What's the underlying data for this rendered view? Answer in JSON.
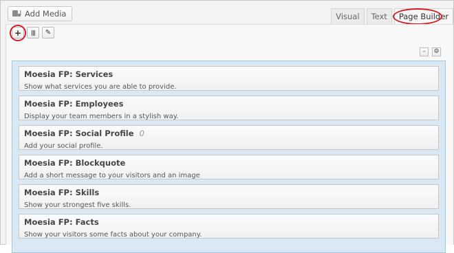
{
  "toolbar": {
    "add_media_label": "Add Media",
    "add_media_icon": "media-icon"
  },
  "tabs": [
    {
      "label": "Visual",
      "active": false
    },
    {
      "label": "Text",
      "active": false
    },
    {
      "label": "Page Builder",
      "active": true
    }
  ],
  "builder_tools": [
    {
      "icon": "plus-icon",
      "glyph": "+"
    },
    {
      "icon": "columns-icon",
      "glyph": "|||"
    },
    {
      "icon": "wrench-icon",
      "glyph": "✎"
    }
  ],
  "panel_controls": [
    {
      "icon": "minimize-icon",
      "glyph": "–"
    },
    {
      "icon": "settings-icon",
      "glyph": "⚙"
    }
  ],
  "widgets": [
    {
      "title": "Moesia FP: Services",
      "badge": "",
      "description": "Show what services you are able to provide."
    },
    {
      "title": "Moesia FP: Employees",
      "badge": "",
      "description": "Display your team members in a stylish way."
    },
    {
      "title": "Moesia FP: Social Profile",
      "badge": "0",
      "description": "Add your social profile."
    },
    {
      "title": "Moesia FP: Blockquote",
      "badge": "",
      "description": "Add a short message to your visitors and an image"
    },
    {
      "title": "Moesia FP: Skills",
      "badge": "",
      "description": "Show your strongest five skills."
    },
    {
      "title": "Moesia FP: Facts",
      "badge": "",
      "description": "Show your visitors some facts about your company."
    }
  ],
  "colors": {
    "annotation": "#d21e26",
    "grid_background": "#d9e8f2",
    "grid_border": "#a6c6de"
  }
}
